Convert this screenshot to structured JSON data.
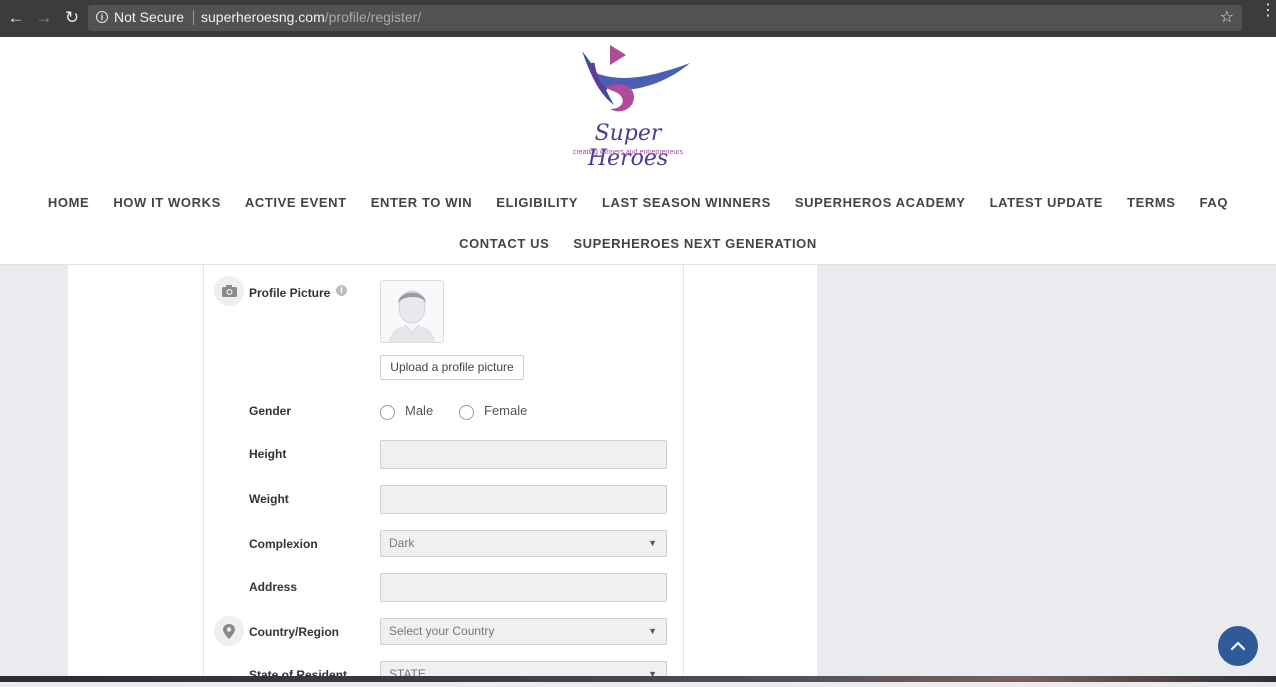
{
  "browser": {
    "security_label": "Not Secure",
    "url_host": "superheroesng.com",
    "url_path": "/profile/register/"
  },
  "header": {
    "logo_title": "Super Heroes",
    "logo_tagline": "creating winners and entrepreneurs",
    "nav_row1": [
      "HOME",
      "HOW IT WORKS",
      "ACTIVE EVENT",
      "ENTER TO WIN",
      "ELIGIBILITY",
      "LAST SEASON WINNERS",
      "SUPERHEROS ACADEMY",
      "LATEST UPDATE",
      "TERMS",
      "FAQ"
    ],
    "nav_row2": [
      "CONTACT US",
      "SUPERHEROES NEXT GENERATION"
    ]
  },
  "form": {
    "profile_picture_label": "Profile Picture",
    "upload_button": "Upload a profile picture",
    "gender_label": "Gender",
    "gender_options": [
      "Male",
      "Female"
    ],
    "height_label": "Height",
    "weight_label": "Weight",
    "complexion_label": "Complexion",
    "complexion_value": "Dark",
    "address_label": "Address",
    "country_label": "Country/Region",
    "country_placeholder": "Select your Country",
    "state_label": "State of Resident",
    "state_placeholder": "STATE"
  },
  "colors": {
    "accent": "#2e5a9a",
    "logo_purple": "#4a3d8f",
    "logo_magenta": "#a54aa0"
  }
}
